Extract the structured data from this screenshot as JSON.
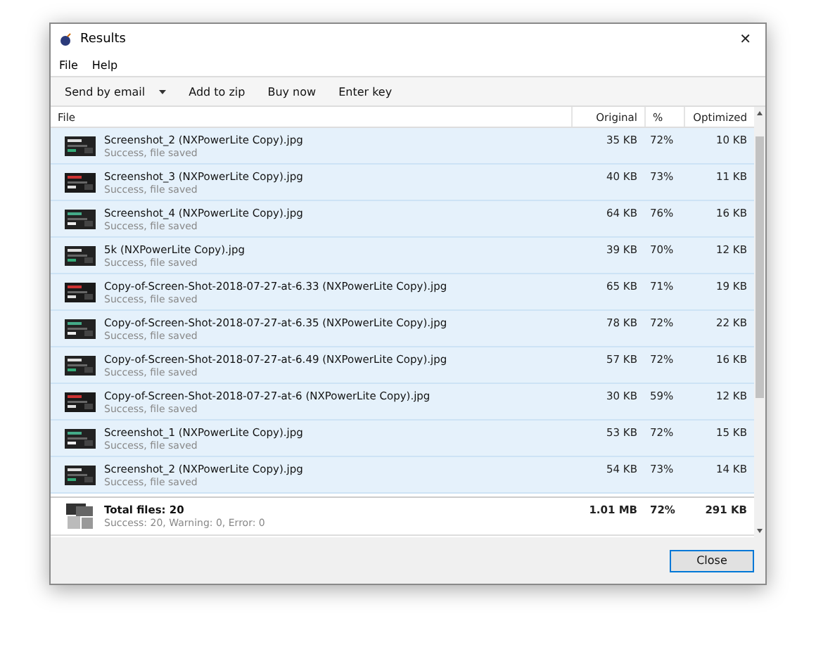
{
  "window": {
    "title": "Results",
    "close": "✕"
  },
  "menu": [
    "File",
    "Help"
  ],
  "toolbar": [
    {
      "label": "Send by email",
      "dropdown": true
    },
    {
      "label": "Add to zip",
      "dropdown": false
    },
    {
      "label": "Buy now",
      "dropdown": false
    },
    {
      "label": "Enter key",
      "dropdown": false
    }
  ],
  "table": {
    "columns": [
      "File",
      "Original",
      "%",
      "Optimized"
    ],
    "rows": [
      {
        "name": "Screenshot_2 (NXPowerLite Copy).jpg",
        "status": "Success, file saved",
        "original": "35 KB",
        "percent": "72%",
        "optimized": "10 KB",
        "selected": true
      },
      {
        "name": "Screenshot_3 (NXPowerLite Copy).jpg",
        "status": "Success, file saved",
        "original": "40 KB",
        "percent": "73%",
        "optimized": "11 KB",
        "selected": true
      },
      {
        "name": "Screenshot_4 (NXPowerLite Copy).jpg",
        "status": "Success, file saved",
        "original": "64 KB",
        "percent": "76%",
        "optimized": "16 KB",
        "selected": true
      },
      {
        "name": "5k (NXPowerLite Copy).jpg",
        "status": "Success, file saved",
        "original": "39 KB",
        "percent": "70%",
        "optimized": "12 KB",
        "selected": true
      },
      {
        "name": "Copy-of-Screen-Shot-2018-07-27-at-6.33 (NXPowerLite Copy).jpg",
        "status": "Success, file saved",
        "original": "65 KB",
        "percent": "71%",
        "optimized": "19 KB",
        "selected": true
      },
      {
        "name": "Copy-of-Screen-Shot-2018-07-27-at-6.35 (NXPowerLite Copy).jpg",
        "status": "Success, file saved",
        "original": "78 KB",
        "percent": "72%",
        "optimized": "22 KB",
        "selected": true
      },
      {
        "name": "Copy-of-Screen-Shot-2018-07-27-at-6.49 (NXPowerLite Copy).jpg",
        "status": "Success, file saved",
        "original": "57 KB",
        "percent": "72%",
        "optimized": "16 KB",
        "selected": true
      },
      {
        "name": "Copy-of-Screen-Shot-2018-07-27-at-6 (NXPowerLite Copy).jpg",
        "status": "Success, file saved",
        "original": "30 KB",
        "percent": "59%",
        "optimized": "12 KB",
        "selected": true
      },
      {
        "name": "Screenshot_1 (NXPowerLite Copy).jpg",
        "status": "Success, file saved",
        "original": "53 KB",
        "percent": "72%",
        "optimized": "15 KB",
        "selected": true
      },
      {
        "name": "Screenshot_2 (NXPowerLite Copy).jpg",
        "status": "Success, file saved",
        "original": "54 KB",
        "percent": "73%",
        "optimized": "14 KB",
        "selected": true
      }
    ],
    "total": {
      "title": "Total files: 20",
      "summary": "Success: 20, Warning: 0, Error: 0",
      "original": "1.01 MB",
      "percent": "72%",
      "optimized": "291 KB"
    }
  },
  "buttons": [
    "Close"
  ]
}
